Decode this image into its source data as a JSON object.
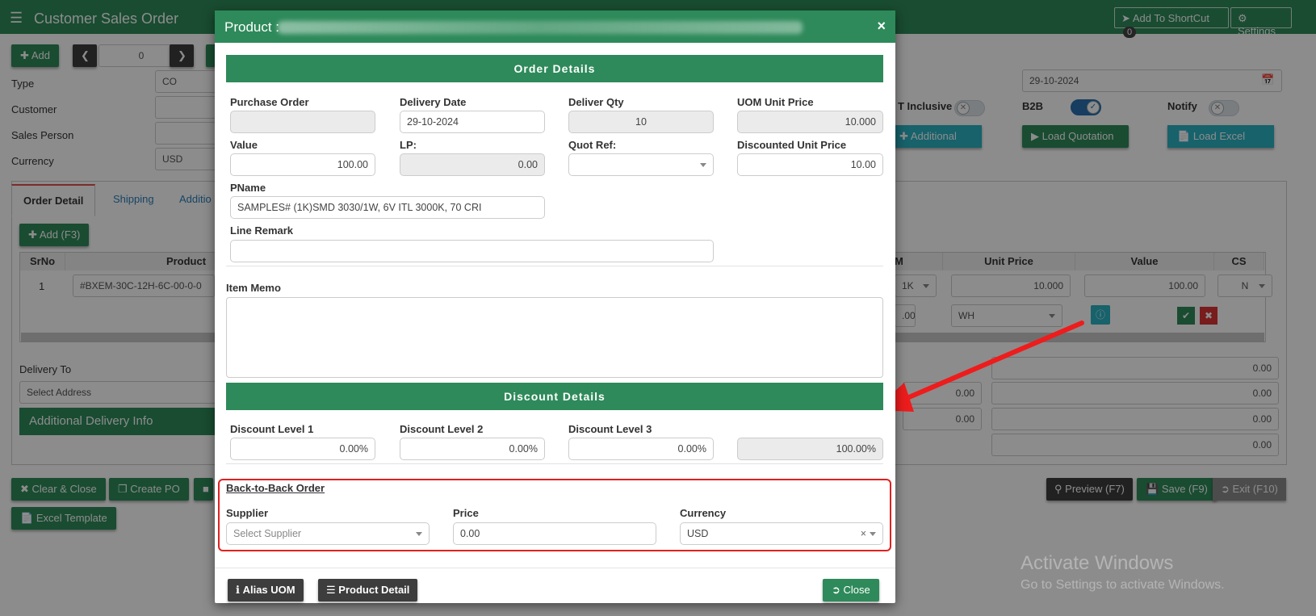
{
  "app": {
    "title": "Customer Sales Order",
    "add_shortcut": "Add To ShortCut",
    "shortcut_count": "0",
    "settings": "Settings",
    "add_button": "Add",
    "nav_counter": "0",
    "labels": {
      "type": "Type",
      "customer": "Customer",
      "sales_person": "Sales Person",
      "currency": "Currency",
      "tax_inclusive": "T Inclusive",
      "b2b": "B2B",
      "notify": "Notify"
    },
    "values": {
      "type": "CO",
      "currency": "USD",
      "date": "29-10-2024"
    },
    "buttons": {
      "additional": "Additional",
      "load_quotation": "Load Quotation",
      "load_excel": "Load Excel",
      "add_f3": "Add (F3)",
      "clear_close": "Clear & Close",
      "create_po": "Create PO",
      "excel_template": "Excel Template",
      "preview": "Preview (F7)",
      "save": "Save (F9)",
      "exit": "Exit (F10)",
      "additional_delivery_info": "Additional Delivery Info"
    },
    "tabs": [
      "Order Detail",
      "Shipping",
      "Additio"
    ],
    "grid": {
      "headers": [
        "SrNo",
        "Product",
        "M",
        "Unit Price",
        "Value",
        "CS"
      ],
      "row": {
        "srno": "1",
        "product": "#BXEM-30C-12H-6C-00-0-0",
        "uom": "1K",
        "unit_price": "10.000",
        "value": "100.00",
        "cs": "N",
        "qty_partial": ".00",
        "warehouse": "WH"
      }
    },
    "delivery_to": "Delivery To",
    "select_address": "Select Address",
    "totals": [
      "0.00",
      "0.00",
      "0.00",
      "0.00"
    ],
    "small_totals": [
      "0.00",
      "0.00"
    ],
    "watermark": {
      "line1": "Activate Windows",
      "line2": "Go to Settings to activate Windows."
    }
  },
  "modal": {
    "title": "Product :",
    "order_details_title": "Order Details",
    "discount_details_title": "Discount Details",
    "fields": {
      "purchase_order": {
        "label": "Purchase Order",
        "value": ""
      },
      "delivery_date": {
        "label": "Delivery Date",
        "value": "29-10-2024"
      },
      "deliver_qty": {
        "label": "Deliver Qty",
        "value": "10"
      },
      "uom_unit_price": {
        "label": "UOM Unit Price",
        "value": "10.000"
      },
      "value": {
        "label": "Value",
        "value": "100.00"
      },
      "lp": {
        "label": "LP:",
        "value": "0.00"
      },
      "quot_ref": {
        "label": "Quot Ref:",
        "value": ""
      },
      "discounted_unit_price": {
        "label": "Discounted Unit Price",
        "value": "10.00"
      },
      "pname": {
        "label": "PName",
        "value": "SAMPLES# (1K)SMD 3030/1W, 6V ITL 3000K, 70 CRI"
      },
      "line_remark": {
        "label": "Line Remark",
        "value": ""
      },
      "item_memo": {
        "label": "Item Memo",
        "value": ""
      },
      "discount_level_1": {
        "label": "Discount Level 1",
        "value": "0.00%"
      },
      "discount_level_2": {
        "label": "Discount Level 2",
        "value": "0.00%"
      },
      "discount_level_3": {
        "label": "Discount Level 3",
        "value": "0.00%"
      },
      "discount_total": {
        "value": "100.00%"
      }
    },
    "back_to_back": {
      "title": "Back-to-Back Order",
      "supplier_label": "Supplier",
      "supplier_placeholder": "Select Supplier",
      "price_label": "Price",
      "price_value": "0.00",
      "currency_label": "Currency",
      "currency_value": "USD"
    },
    "footer": {
      "alias_uom": "Alias UOM",
      "product_detail": "Product Detail",
      "close": "Close"
    }
  },
  "colors": {
    "primary_green": "#2e8a5a",
    "dark_button": "#3d3d3d",
    "teal": "#2bb3c4",
    "highlight_red": "#e02020"
  }
}
